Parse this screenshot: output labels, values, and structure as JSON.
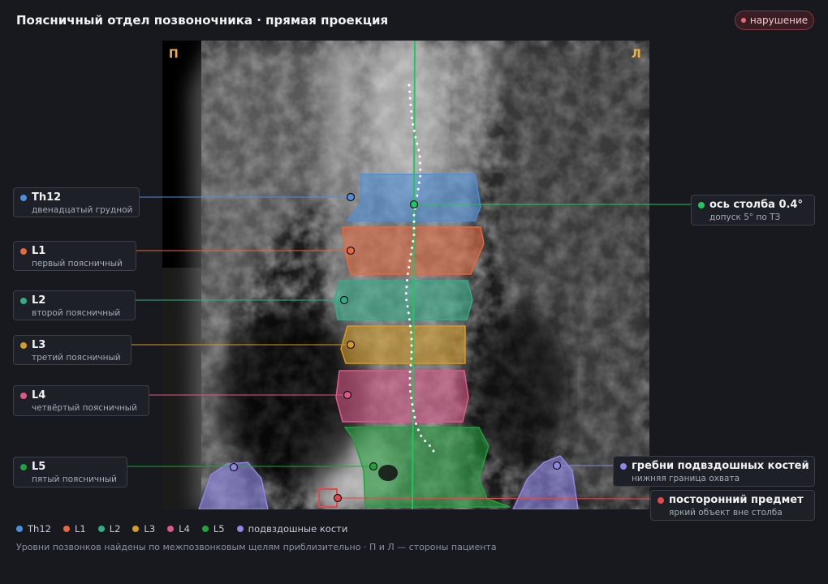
{
  "header": {
    "title": "Поясничный отдел позвоночника · прямая проекция",
    "badge": "нарушение"
  },
  "orientation": {
    "right": "П",
    "left": "Л"
  },
  "colors": {
    "th12": "#4a8fe0",
    "l1": "#e8683a",
    "l2": "#2fae86",
    "l3": "#d79a22",
    "l4": "#e0588a",
    "l5": "#1fa33a",
    "iliac": "#8f86e6",
    "axis": "#22c55e",
    "foreign": "#e04a4a"
  },
  "labels": {
    "th12": {
      "name": "Th12",
      "sub": "двенадцатый грудной"
    },
    "l1": {
      "name": "L1",
      "sub": "первый поясничный"
    },
    "l2": {
      "name": "L2",
      "sub": "второй поясничный"
    },
    "l3": {
      "name": "L3",
      "sub": "третий поясничный"
    },
    "l4": {
      "name": "L4",
      "sub": "четвёртый поясничный"
    },
    "l5": {
      "name": "L5",
      "sub": "пятый поясничный"
    },
    "axis": {
      "name": "ось столба 0.4°",
      "sub": "допуск 5° по ТЗ"
    },
    "iliac": {
      "name": "гребни подвздошных костей",
      "sub": "нижняя граница охвата"
    },
    "foreign": {
      "name": "посторонний предмет",
      "sub": "яркий объект вне столба"
    }
  },
  "legend": [
    {
      "key": "th12",
      "label": "Th12"
    },
    {
      "key": "l1",
      "label": "L1"
    },
    {
      "key": "l2",
      "label": "L2"
    },
    {
      "key": "l3",
      "label": "L3"
    },
    {
      "key": "l4",
      "label": "L4"
    },
    {
      "key": "l5",
      "label": "L5"
    },
    {
      "key": "iliac",
      "label": "подвздошные кости"
    }
  ],
  "footer": {
    "note": "Уровни позвонков найдены по межпозвонковым щелям приблизительно · П и Л — стороны пациента"
  }
}
